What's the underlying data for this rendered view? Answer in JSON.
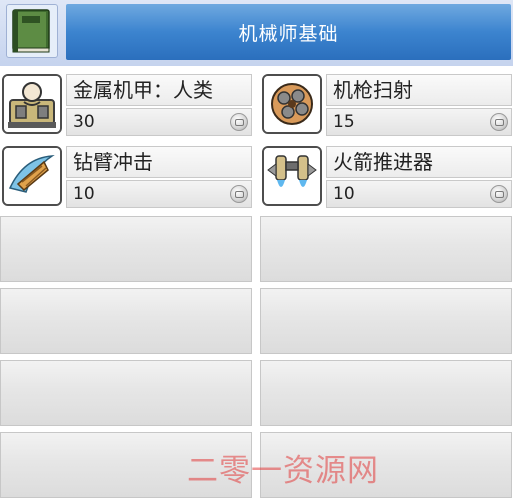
{
  "header": {
    "title": "机械师基础",
    "book_icon": "green-book-icon"
  },
  "skills": [
    {
      "name": "金属机甲：人类",
      "level": "30",
      "icon": "metal-mech-human-icon"
    },
    {
      "name": "机枪扫射",
      "level": "15",
      "icon": "gatling-gun-icon"
    },
    {
      "name": "钻臂冲击",
      "level": "10",
      "icon": "drill-arm-icon"
    },
    {
      "name": "火箭推进器",
      "level": "10",
      "icon": "rocket-booster-icon"
    }
  ],
  "level_up_icon": "level-up-icon",
  "watermark": "二零一资源网",
  "colors": {
    "title_bar": "#3c84cf",
    "header_bg": "#c5d3ee",
    "slot_bg": "#e6e6e6",
    "watermark": "#e23c3c"
  }
}
